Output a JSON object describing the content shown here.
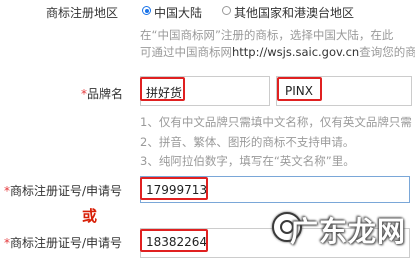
{
  "region": {
    "label": "商标注册地区",
    "options": [
      {
        "label": "中国大陆",
        "selected": true
      },
      {
        "label": "其他国家和港澳台地区",
        "selected": false
      }
    ],
    "hint_line1": "在“中国商标网”注册的商标，选择中国大陆，在此",
    "hint_line2_prefix": "可通过中国商标网",
    "hint_line2_link": "http://wsjs.saic.gov.cn",
    "hint_line2_suffix": "查询您的商标"
  },
  "brand": {
    "required_mark": "*",
    "label": "品牌名",
    "chinese_name": "拼好货",
    "english_name": "PINX",
    "notes": [
      "1、仅有中文品牌只需填中文名称，仅有英文品牌只需",
      "2、拼音、繁体、图形的商标不支持申请。",
      "3、纯阿拉伯数字，填写在“英文名称”里。"
    ]
  },
  "reg_number_1": {
    "required_mark": "*",
    "label": "商标注册证号/申请号",
    "value": "17999713"
  },
  "or_text": "或",
  "reg_number_2": {
    "required_mark": "*",
    "label": "商标注册证号/申请号",
    "value": "18382264"
  },
  "watermark": {
    "text": "广东龙网",
    "icon": "watermark-logo-icon"
  },
  "colors": {
    "accent": "#1a73e8",
    "required": "#e4393c",
    "highlight_box": "#e02020",
    "or_text": "#d81e06"
  }
}
